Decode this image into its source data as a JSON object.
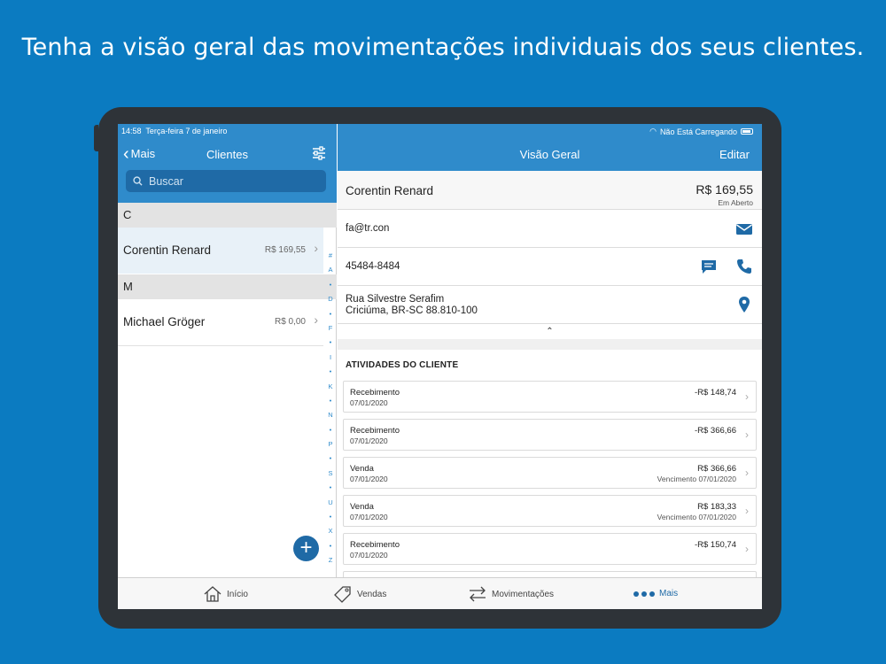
{
  "headline": "Tenha a visão geral das movimentações individuais dos seus clientes.",
  "status_bar": {
    "time": "14:58",
    "date": "Terça-feira 7 de janeiro",
    "battery_text": "Não Está Carregando"
  },
  "left_nav": {
    "back_label": "Mais",
    "title": "Clientes",
    "search_placeholder": "Buscar"
  },
  "sections": [
    {
      "letter": "C",
      "clients": [
        {
          "name": "Corentin Renard",
          "amount": "R$ 169,55"
        }
      ]
    },
    {
      "letter": "M",
      "clients": [
        {
          "name": "Michael Gröger",
          "amount": "R$ 0,00"
        }
      ]
    }
  ],
  "index_letters": [
    "#",
    "A",
    "•",
    "D",
    "•",
    "F",
    "•",
    "I",
    "•",
    "K",
    "•",
    "N",
    "•",
    "P",
    "•",
    "S",
    "•",
    "U",
    "•",
    "X",
    "•",
    "Z"
  ],
  "right_nav": {
    "title": "Visão Geral",
    "edit_label": "Editar"
  },
  "customer": {
    "name": "Corentin Renard",
    "amount": "R$ 169,55",
    "status": "Em Aberto",
    "email": "fa@tr.con",
    "phone": "45484-8484",
    "address_line1": "Rua Silvestre Serafim",
    "address_line2": "Criciúma, BR-SC 88.810-100"
  },
  "activities_title": "ATIVIDADES DO CLIENTE",
  "activities": [
    {
      "type": "Recebimento",
      "date": "07/01/2020",
      "value": "-R$ 148,74",
      "sub": ""
    },
    {
      "type": "Recebimento",
      "date": "07/01/2020",
      "value": "-R$ 366,66",
      "sub": ""
    },
    {
      "type": "Venda",
      "date": "07/01/2020",
      "value": "R$ 366,66",
      "sub": "Vencimento 07/01/2020"
    },
    {
      "type": "Venda",
      "date": "07/01/2020",
      "value": "R$ 183,33",
      "sub": "Vencimento 07/01/2020"
    },
    {
      "type": "Recebimento",
      "date": "07/01/2020",
      "value": "-R$ 150,74",
      "sub": ""
    }
  ],
  "tabs": [
    {
      "label": "Início",
      "icon": "home-icon"
    },
    {
      "label": "Vendas",
      "icon": "tag-icon"
    },
    {
      "label": "Movimentações",
      "icon": "transfer-icon"
    },
    {
      "label": "Mais",
      "icon": "more-icon"
    }
  ],
  "colors": {
    "background": "#0b7bc1",
    "nav": "#2f8bcb",
    "accent": "#1f6aa6"
  }
}
